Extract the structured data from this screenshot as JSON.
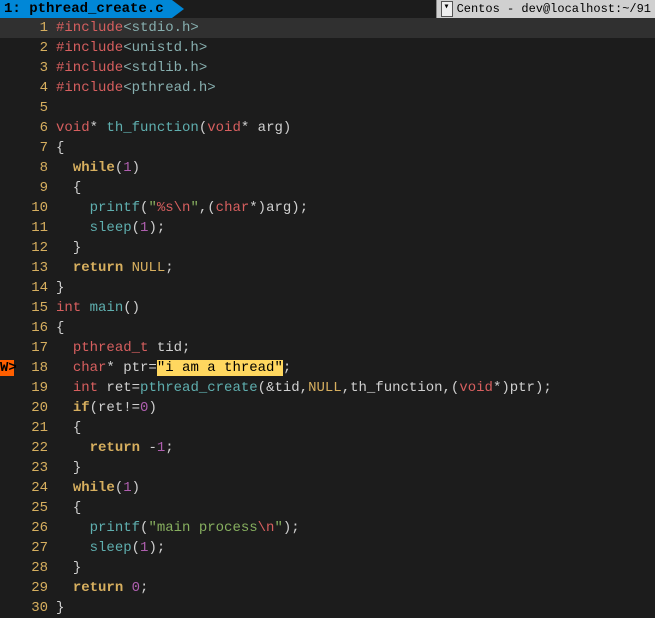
{
  "tab": {
    "label": "1: pthread_create.c"
  },
  "session": {
    "label": "Centos - dev@localhost:~/91"
  },
  "lines": [
    {
      "n": "1",
      "mark": "",
      "hl": true,
      "html": "<span class='c-preproc'>#include</span><span class='c-include'>&lt;stdio.h&gt;</span>"
    },
    {
      "n": "2",
      "mark": "",
      "html": "<span class='c-preproc'>#include</span><span class='c-include'>&lt;unistd.h&gt;</span>"
    },
    {
      "n": "3",
      "mark": "",
      "html": "<span class='c-preproc'>#include</span><span class='c-include'>&lt;stdlib.h&gt;</span>"
    },
    {
      "n": "4",
      "mark": "",
      "html": "<span class='c-preproc'>#include</span><span class='c-include'>&lt;pthread.h&gt;</span>"
    },
    {
      "n": "5",
      "mark": "",
      "html": ""
    },
    {
      "n": "6",
      "mark": "",
      "html": "<span class='c-type'>void</span><span class='c-punct'>* </span><span class='c-func'>th_function</span><span class='c-punct'>(</span><span class='c-type'>void</span><span class='c-punct'>* arg)</span>"
    },
    {
      "n": "7",
      "mark": "",
      "html": "<span class='c-punct'>{</span>"
    },
    {
      "n": "8",
      "mark": "",
      "html": "  <span class='c-keyword'>while</span><span class='c-punct'>(</span><span class='c-num'>1</span><span class='c-punct'>)</span>"
    },
    {
      "n": "9",
      "mark": "",
      "html": "  <span class='c-punct'>{</span>"
    },
    {
      "n": "10",
      "mark": "",
      "html": "    <span class='c-func'>printf</span><span class='c-punct'>(</span><span class='c-str'>\"</span><span class='c-esc'>%s\\n</span><span class='c-str'>\"</span><span class='c-punct'>,(</span><span class='c-type'>char</span><span class='c-punct'>*)arg);</span>"
    },
    {
      "n": "11",
      "mark": "",
      "html": "    <span class='c-func'>sleep</span><span class='c-punct'>(</span><span class='c-num'>1</span><span class='c-punct'>);</span>"
    },
    {
      "n": "12",
      "mark": "",
      "html": "  <span class='c-punct'>}</span>"
    },
    {
      "n": "13",
      "mark": "",
      "html": "  <span class='c-keyword'>return</span> <span class='c-const'>NULL</span><span class='c-punct'>;</span>"
    },
    {
      "n": "14",
      "mark": "",
      "html": "<span class='c-punct'>}</span>"
    },
    {
      "n": "15",
      "mark": "",
      "html": "<span class='c-type'>int</span> <span class='c-func'>main</span><span class='c-punct'>()</span>"
    },
    {
      "n": "16",
      "mark": "",
      "html": "<span class='c-punct'>{</span>"
    },
    {
      "n": "17",
      "mark": "",
      "html": "  <span class='c-type'>pthread_t</span> tid<span class='c-punct'>;</span>"
    },
    {
      "n": "18",
      "mark": "W>",
      "html": "  <span class='c-type'>char</span><span class='c-punct'>* ptr=</span><span class='c-strlit'>\"i am a thread\"</span><span class='c-punct'>;</span>"
    },
    {
      "n": "19",
      "mark": "",
      "html": "  <span class='c-type'>int</span> ret<span class='c-punct'>=</span><span class='c-func'>pthread_create</span><span class='c-punct'>(&amp;tid,</span><span class='c-const'>NULL</span><span class='c-punct'>,th_function,(</span><span class='c-type'>void</span><span class='c-punct'>*)ptr);</span>"
    },
    {
      "n": "20",
      "mark": "",
      "html": "  <span class='c-keyword'>if</span><span class='c-punct'>(ret!=</span><span class='c-num'>0</span><span class='c-punct'>)</span>"
    },
    {
      "n": "21",
      "mark": "",
      "html": "  <span class='c-punct'>{</span>"
    },
    {
      "n": "22",
      "mark": "",
      "html": "    <span class='c-keyword'>return</span> <span class='c-punct'>-</span><span class='c-num'>1</span><span class='c-punct'>;</span>"
    },
    {
      "n": "23",
      "mark": "",
      "html": "  <span class='c-punct'>}</span>"
    },
    {
      "n": "24",
      "mark": "",
      "html": "  <span class='c-keyword'>while</span><span class='c-punct'>(</span><span class='c-num'>1</span><span class='c-punct'>)</span>"
    },
    {
      "n": "25",
      "mark": "",
      "html": "  <span class='c-punct'>{</span>"
    },
    {
      "n": "26",
      "mark": "",
      "html": "    <span class='c-func'>printf</span><span class='c-punct'>(</span><span class='c-str'>\"main process</span><span class='c-esc'>\\n</span><span class='c-str'>\"</span><span class='c-punct'>);</span>"
    },
    {
      "n": "27",
      "mark": "",
      "html": "    <span class='c-func'>sleep</span><span class='c-punct'>(</span><span class='c-num'>1</span><span class='c-punct'>);</span>"
    },
    {
      "n": "28",
      "mark": "",
      "html": "  <span class='c-punct'>}</span>"
    },
    {
      "n": "29",
      "mark": "",
      "html": "  <span class='c-keyword'>return</span> <span class='c-num'>0</span><span class='c-punct'>;</span>"
    },
    {
      "n": "30",
      "mark": "",
      "html": "<span class='c-punct'>}</span>"
    }
  ]
}
